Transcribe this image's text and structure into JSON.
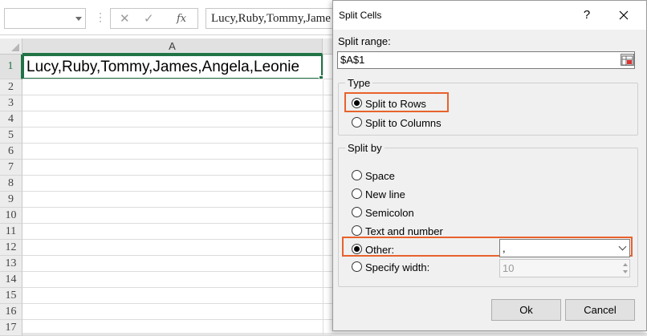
{
  "spreadsheet": {
    "formula_content": "Lucy,Ruby,Tommy,Jame",
    "column_header": "A",
    "row_numbers": [
      "1",
      "2",
      "3",
      "4",
      "5",
      "6",
      "7",
      "8",
      "9",
      "10",
      "11",
      "12",
      "13",
      "14",
      "15",
      "16",
      "17"
    ],
    "cell_a1": "Lucy,Ruby,Tommy,James,Angela,Leonie",
    "formula_dots": "⋮",
    "cancel_glyph": "✕",
    "enter_glyph": "✓",
    "fx_glyph": "fx"
  },
  "dialog": {
    "title": "Split Cells",
    "help_glyph": "?",
    "split_range_label": "Split range:",
    "split_range_value": "$A$1",
    "type_group": {
      "title": "Type",
      "options": [
        {
          "label": "Split to Rows",
          "checked": true
        },
        {
          "label": "Split to Columns",
          "checked": false
        }
      ]
    },
    "split_by_group": {
      "title": "Split by",
      "options": [
        {
          "label": "Space",
          "checked": false
        },
        {
          "label": "New line",
          "checked": false
        },
        {
          "label": "Semicolon",
          "checked": false
        },
        {
          "label": "Text and number",
          "checked": false
        },
        {
          "label": "Other:",
          "checked": true
        },
        {
          "label": "Specify width:",
          "checked": false
        }
      ],
      "other_value": ",",
      "width_value": "10"
    },
    "ok_label": "Ok",
    "cancel_label": "Cancel"
  },
  "colors": {
    "excel_accent": "#217346",
    "highlight": "#e8622c",
    "dialog_bg": "#f0f0f0"
  }
}
